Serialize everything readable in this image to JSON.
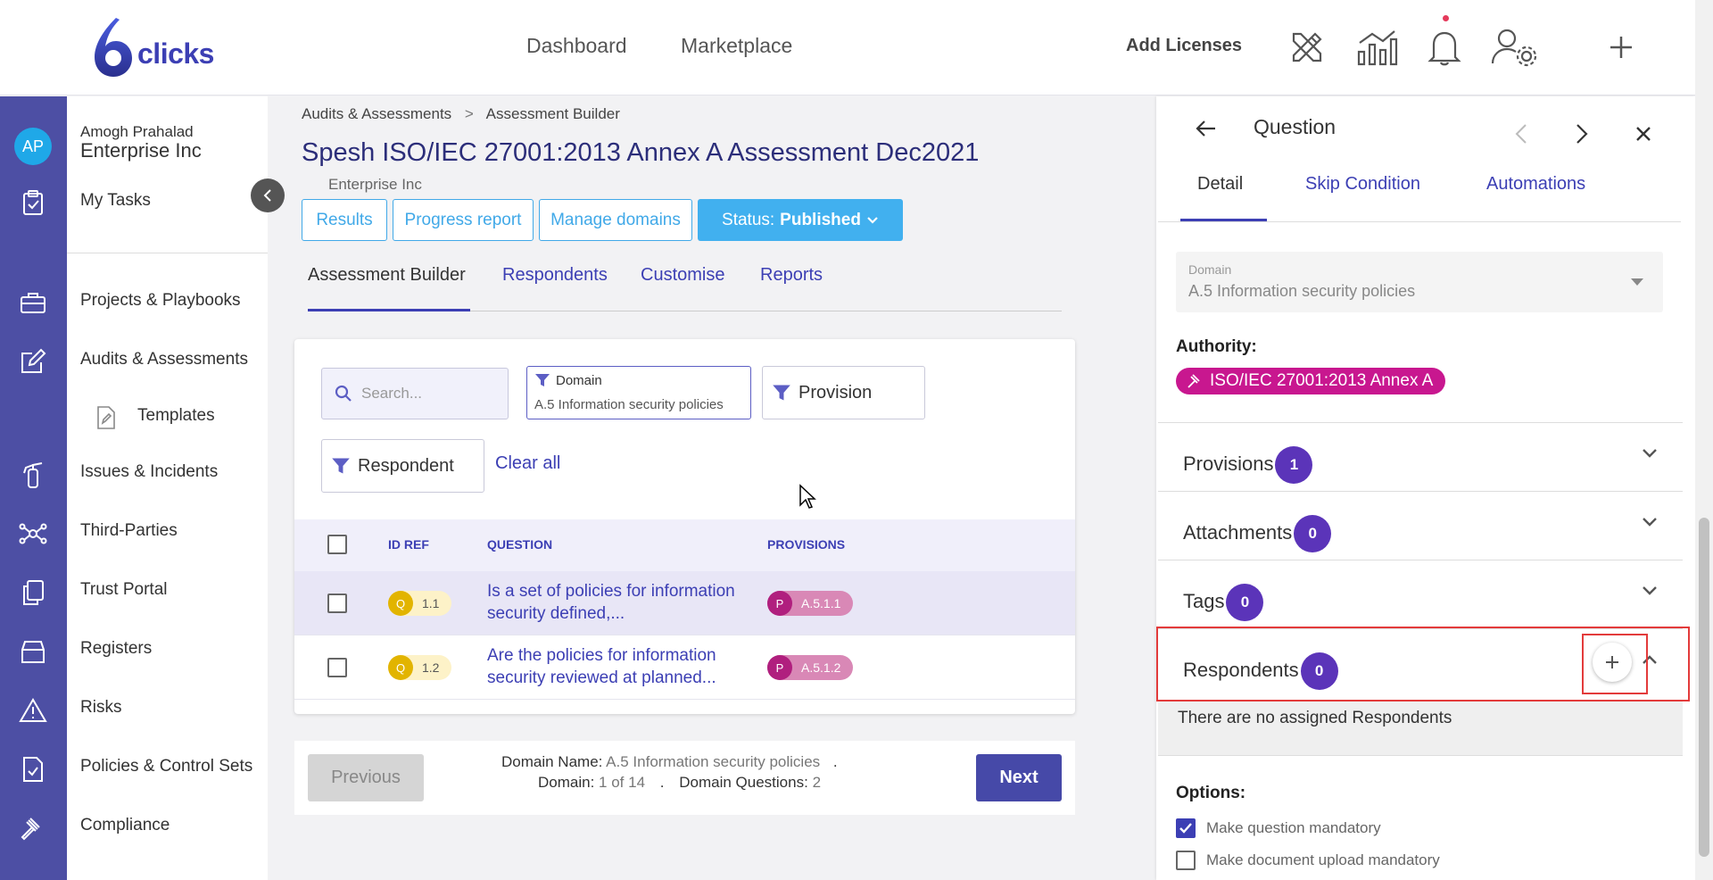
{
  "header": {
    "logo_text": "clicks",
    "nav": [
      "Dashboard",
      "Marketplace"
    ],
    "add_licenses": "Add Licenses"
  },
  "user": {
    "initials": "AP",
    "name": "Amogh Prahalad",
    "org": "Enterprise Inc"
  },
  "sidebar": {
    "items": [
      {
        "label": "My Tasks",
        "icon": "clipboard-check-icon"
      },
      {
        "label": "Projects & Playbooks",
        "icon": "briefcase-icon"
      },
      {
        "label": "Audits & Assessments",
        "icon": "edit-icon"
      },
      {
        "label": "Templates",
        "icon": "file-edit-icon"
      },
      {
        "label": "Issues & Incidents",
        "icon": "fire-extinguisher-icon"
      },
      {
        "label": "Third-Parties",
        "icon": "network-icon"
      },
      {
        "label": "Trust Portal",
        "icon": "documents-icon"
      },
      {
        "label": "Registers",
        "icon": "archive-icon"
      },
      {
        "label": "Risks",
        "icon": "warning-icon"
      },
      {
        "label": "Policies & Control Sets",
        "icon": "policy-icon"
      },
      {
        "label": "Compliance",
        "icon": "gavel-icon"
      }
    ]
  },
  "main": {
    "breadcrumb": [
      "Audits & Assessments",
      "Assessment Builder"
    ],
    "title": "Spesh ISO/IEC 27001:2013 Annex A Assessment Dec2021",
    "subtitle": "Enterprise Inc",
    "buttons": [
      "Results",
      "Progress report",
      "Manage domains"
    ],
    "status_label": "Status:",
    "status_value": "Published",
    "tabs": [
      "Assessment Builder",
      "Respondents",
      "Customise",
      "Reports"
    ],
    "search_placeholder": "Search...",
    "filters": {
      "domain_label": "Domain",
      "domain_value": "A.5 Information security policies",
      "provision": "Provision",
      "respondent": "Respondent",
      "clear_all": "Clear all"
    },
    "table": {
      "headers": [
        "ID REF",
        "QUESTION",
        "PROVISIONS"
      ],
      "rows": [
        {
          "q": "Q",
          "id": "1.1",
          "question": "Is a set of policies for information security defined,...",
          "p": "P",
          "provision": "A.5.1.1"
        },
        {
          "q": "Q",
          "id": "1.2",
          "question": "Are the policies for information security reviewed at planned...",
          "p": "P",
          "provision": "A.5.1.2"
        }
      ]
    },
    "pager": {
      "previous": "Previous",
      "next": "Next",
      "domain_name_label": "Domain Name:",
      "domain_name_value": "A.5 Information security policies",
      "domain_label": "Domain:",
      "domain_value": "1 of 14",
      "questions_label": "Domain Questions:",
      "questions_value": "2",
      "dot": "."
    }
  },
  "panel": {
    "title": "Question",
    "tabs": [
      "Detail",
      "Skip Condition",
      "Automations"
    ],
    "domain_label": "Domain",
    "domain_value": "A.5 Information security policies",
    "authority_label": "Authority:",
    "authority_value": "ISO/IEC 27001:2013 Annex A",
    "sections": [
      {
        "title": "Provisions",
        "count": "1"
      },
      {
        "title": "Attachments",
        "count": "0"
      },
      {
        "title": "Tags",
        "count": "0"
      },
      {
        "title": "Respondents",
        "count": "0"
      }
    ],
    "no_respondents": "There are no assigned Respondents",
    "options_label": "Options:",
    "options": [
      {
        "label": "Make question mandatory",
        "checked": true
      },
      {
        "label": "Make document upload mandatory",
        "checked": false
      }
    ]
  },
  "colors": {
    "brand": "#3c3fb4",
    "rail": "#4d4fa4",
    "status": "#41b0ef",
    "count_badge": "#5b34b9",
    "authority": "#c8178f",
    "annotation": "#e33b3b"
  }
}
